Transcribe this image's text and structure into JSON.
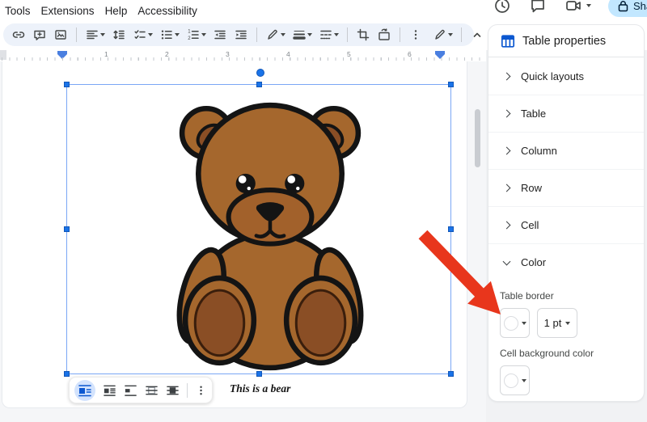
{
  "menu": {
    "items": [
      "Tools",
      "Extensions",
      "Help",
      "Accessibility"
    ]
  },
  "topbar": {
    "share_label": "Share"
  },
  "toolbar_icons": [
    "insert-link",
    "add-comment",
    "insert-image",
    "align",
    "line-spacing",
    "checklist",
    "bulleted-list",
    "numbered-list",
    "decrease-indent",
    "increase-indent",
    "border-color-pen",
    "border-width",
    "border-dash",
    "crop-image",
    "replace-image",
    "more-options-kebab",
    "editing-mode-pen",
    "hide-menus-chevron-up"
  ],
  "topright_icons": [
    "version-history",
    "open-comments",
    "meet-video-call",
    "share-lock"
  ],
  "ruler": {
    "marks": [
      "1",
      "2",
      "3",
      "4",
      "5",
      "6"
    ]
  },
  "doc": {
    "caption": "This is a bear"
  },
  "wrap_toolbar_icons": [
    "wrap-inline",
    "wrap-text",
    "break-text",
    "behind-text",
    "in-front-of-text",
    "more-options-kebab"
  ],
  "sidebar": {
    "title": "Table properties",
    "sections": [
      {
        "label": "Quick layouts",
        "expanded": false
      },
      {
        "label": "Table",
        "expanded": false
      },
      {
        "label": "Column",
        "expanded": false
      },
      {
        "label": "Row",
        "expanded": false
      },
      {
        "label": "Cell",
        "expanded": false
      },
      {
        "label": "Color",
        "expanded": true
      }
    ],
    "color": {
      "table_border_label": "Table border",
      "border_width_value": "1 pt",
      "cell_background_label": "Cell background color"
    }
  },
  "colors": {
    "accent_blue": "#0b57d0",
    "selection_blue": "#1a73e8",
    "arrow_red": "#e8361c",
    "share_pill_bg": "#c2e7ff",
    "bear_fur": "#a5672d",
    "bear_dark": "#8a4e25",
    "bear_muzzle": "#a2612b",
    "outline_black": "#141414"
  }
}
